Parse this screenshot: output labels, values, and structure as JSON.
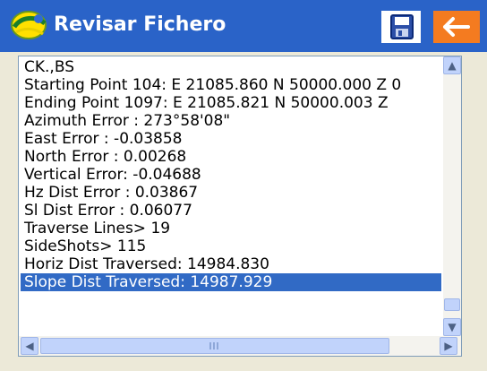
{
  "titlebar": {
    "title": "Revisar Fichero",
    "icons": {
      "app": "app-logo-icon",
      "save": "save-icon",
      "back": "back-arrow-icon"
    }
  },
  "file_view": {
    "lines": [
      "CK.,BS",
      "Starting Point 104: E 21085.860 N 50000.000 Z 0",
      "Ending   Point 1097: E 21085.821 N 50000.003 Z",
      "Azimuth Error : 273°58'08\"",
      "East Error    : -0.03858",
      "North Error   : 0.00268",
      "Vertical Error: -0.04688",
      "Hz Dist Error : 0.03867",
      "Sl Dist Error : 0.06077",
      "Traverse Lines> 19",
      "SideShots> 115",
      "Horiz Dist Traversed: 14984.830",
      "Slope Dist Traversed: 14987.929"
    ],
    "selected_line": "Slope Dist Traversed: 14987.929"
  },
  "colors": {
    "titlebar": "#2a63c8",
    "back_button": "#f47b20",
    "selection": "#316ac5"
  }
}
